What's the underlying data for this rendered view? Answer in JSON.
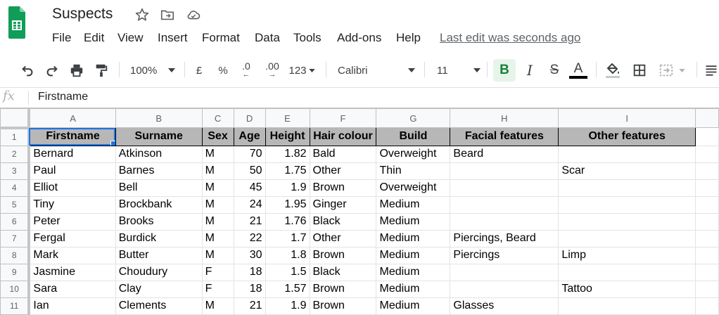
{
  "app": {
    "title": "Suspects",
    "last_edit": "Last edit was seconds ago"
  },
  "menu": [
    "File",
    "Edit",
    "View",
    "Insert",
    "Format",
    "Data",
    "Tools",
    "Add-ons",
    "Help"
  ],
  "toolbar": {
    "zoom": "100%",
    "currency": "£",
    "percent": "%",
    "decrease_decimal": ".0",
    "increase_decimal": ".00",
    "more_formats": "123",
    "font": "Calibri",
    "font_size": "11",
    "bold": "B",
    "italic": "I",
    "strikethrough": "S",
    "text_color": "A",
    "text_color_value": "#000000"
  },
  "formula_bar": {
    "fx": "fx",
    "content": "Firstname"
  },
  "sheet": {
    "columns": [
      "A",
      "B",
      "C",
      "D",
      "E",
      "F",
      "G",
      "H",
      "I"
    ],
    "row_numbers": [
      "1",
      "2",
      "3",
      "4",
      "5",
      "6",
      "7",
      "8",
      "9",
      "10",
      "11"
    ],
    "headers": [
      "Firstname",
      "Surname",
      "Sex",
      "Age",
      "Height",
      "Hair colour",
      "Build",
      "Facial features",
      "Other features"
    ],
    "rows": [
      [
        "Bernard",
        "Atkinson",
        "M",
        "70",
        "1.82",
        "Bald",
        "Overweight",
        "Beard",
        ""
      ],
      [
        "Paul",
        "Barnes",
        "M",
        "50",
        "1.75",
        "Other",
        "Thin",
        "",
        "Scar"
      ],
      [
        "Elliot",
        "Bell",
        "M",
        "45",
        "1.9",
        "Brown",
        "Overweight",
        "",
        ""
      ],
      [
        "Tiny",
        "Brockbank",
        "M",
        "24",
        "1.95",
        "Ginger",
        "Medium",
        "",
        ""
      ],
      [
        "Peter",
        "Brooks",
        "M",
        "21",
        "1.76",
        "Black",
        "Medium",
        "",
        ""
      ],
      [
        "Fergal",
        "Burdick",
        "M",
        "22",
        "1.7",
        "Other",
        "Medium",
        "Piercings, Beard",
        ""
      ],
      [
        "Mark",
        "Butter",
        "M",
        "30",
        "1.8",
        "Brown",
        "Medium",
        "Piercings",
        "Limp"
      ],
      [
        "Jasmine",
        "Choudury",
        "F",
        "18",
        "1.5",
        "Black",
        "Medium",
        "",
        ""
      ],
      [
        "Sara",
        "Clay",
        "F",
        "18",
        "1.57",
        "Brown",
        "Medium",
        "",
        "Tattoo"
      ],
      [
        "Ian",
        "Clements",
        "M",
        "21",
        "1.9",
        "Brown",
        "Medium",
        "Glasses",
        ""
      ]
    ]
  }
}
